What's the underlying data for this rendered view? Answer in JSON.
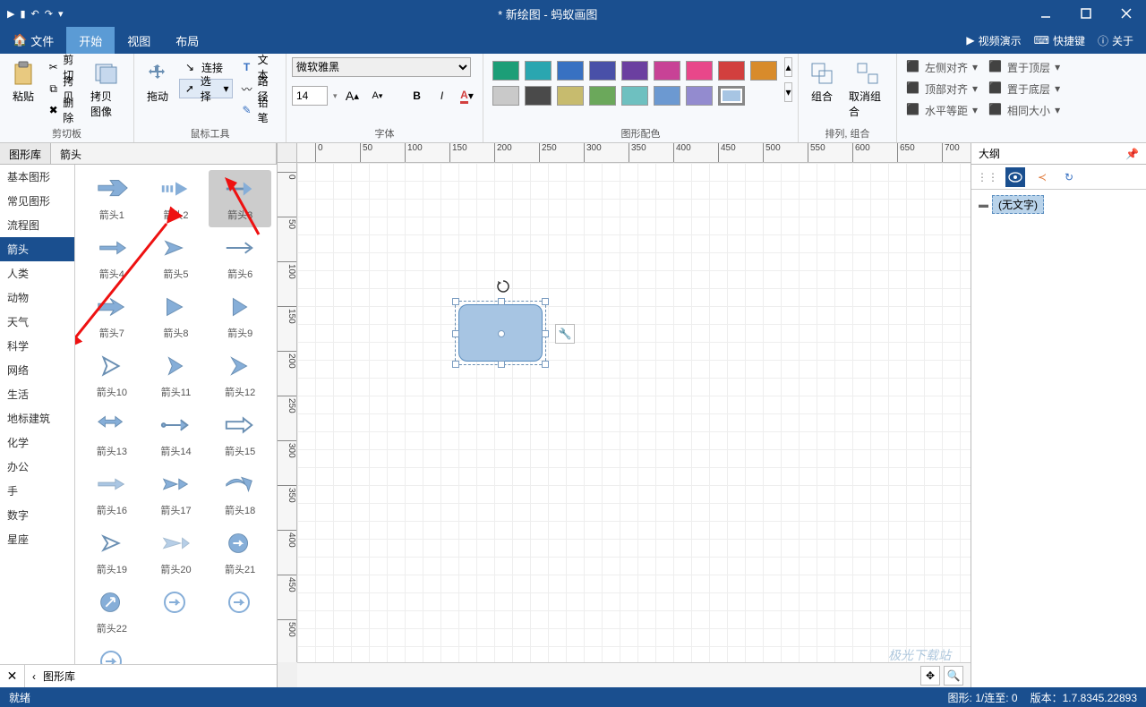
{
  "title": "* 新绘图 - 蚂蚁画图",
  "menus": {
    "file": "文件",
    "home": "开始",
    "view": "视图",
    "layout": "布局"
  },
  "top_right": {
    "video": "视频演示",
    "shortcuts": "快捷键",
    "about": "关于"
  },
  "ribbon": {
    "clipboard": {
      "paste": "粘贴",
      "cut": "剪切",
      "copy": "拷贝",
      "delete": "删除",
      "copy_image": "拷贝图像",
      "label": "剪切板"
    },
    "mouse": {
      "drag": "拖动",
      "connect": "连接",
      "select": "选择",
      "text": "文本",
      "path": "路径",
      "pencil": "铅笔",
      "label": "鼠标工具"
    },
    "font": {
      "family": "微软雅黑",
      "size": "14",
      "label": "字体"
    },
    "colors": {
      "row1": [
        "#1c9e77",
        "#2aa6b0",
        "#3871c2",
        "#4950a8",
        "#6b3fa0",
        "#c84296",
        "#e8478a",
        "#d23f3e",
        "#d88b2b"
      ],
      "row2": [
        "#c9c9c9",
        "#4a4a4a",
        "#c7bb6e",
        "#6ba85b",
        "#6ec0c0",
        "#6c99d1",
        "#938bcf",
        "#a7c5e3"
      ],
      "label": "图形配色"
    },
    "combine": {
      "group": "组合",
      "ungroup": "取消组合",
      "label": "排列, 组合"
    },
    "arrange": {
      "left": "左侧对齐",
      "top": "置于顶层",
      "topalign": "顶部对齐",
      "bottom": "置于底层",
      "hspace": "水平等距",
      "samesize": "相同大小"
    }
  },
  "left": {
    "library_tab": "图形库",
    "current_cat": "箭头",
    "categories": [
      "基本图形",
      "常见图形",
      "流程图",
      "箭头",
      "人类",
      "动物",
      "天气",
      "科学",
      "网络",
      "生活",
      "地标建筑",
      "化学",
      "办公",
      "手",
      "数字",
      "星座"
    ],
    "shapes": [
      "箭头1",
      "箭头2",
      "箭头3",
      "箭头4",
      "箭头5",
      "箭头6",
      "箭头7",
      "箭头8",
      "箭头9",
      "箭头10",
      "箭头11",
      "箭头12",
      "箭头13",
      "箭头14",
      "箭头15",
      "箭头16",
      "箭头17",
      "箭头18",
      "箭头19",
      "箭头20",
      "箭头21",
      "箭头22"
    ],
    "footer_crumb": "图形库"
  },
  "right": {
    "title": "大纲",
    "tree_item": "(无文字)"
  },
  "status": {
    "left": "就绪",
    "shapes_sel": "图形: 1/连至: 0",
    "version": "版本：1.7.8345.22893"
  },
  "ruler_h": [
    "0",
    "50",
    "100",
    "150",
    "200",
    "250",
    "300",
    "350",
    "400",
    "450",
    "500",
    "550",
    "600",
    "650",
    "700"
  ],
  "ruler_v": [
    "0",
    "50",
    "100",
    "150",
    "200",
    "250",
    "300",
    "350",
    "400",
    "450",
    "500"
  ],
  "watermark": "极光下载站"
}
